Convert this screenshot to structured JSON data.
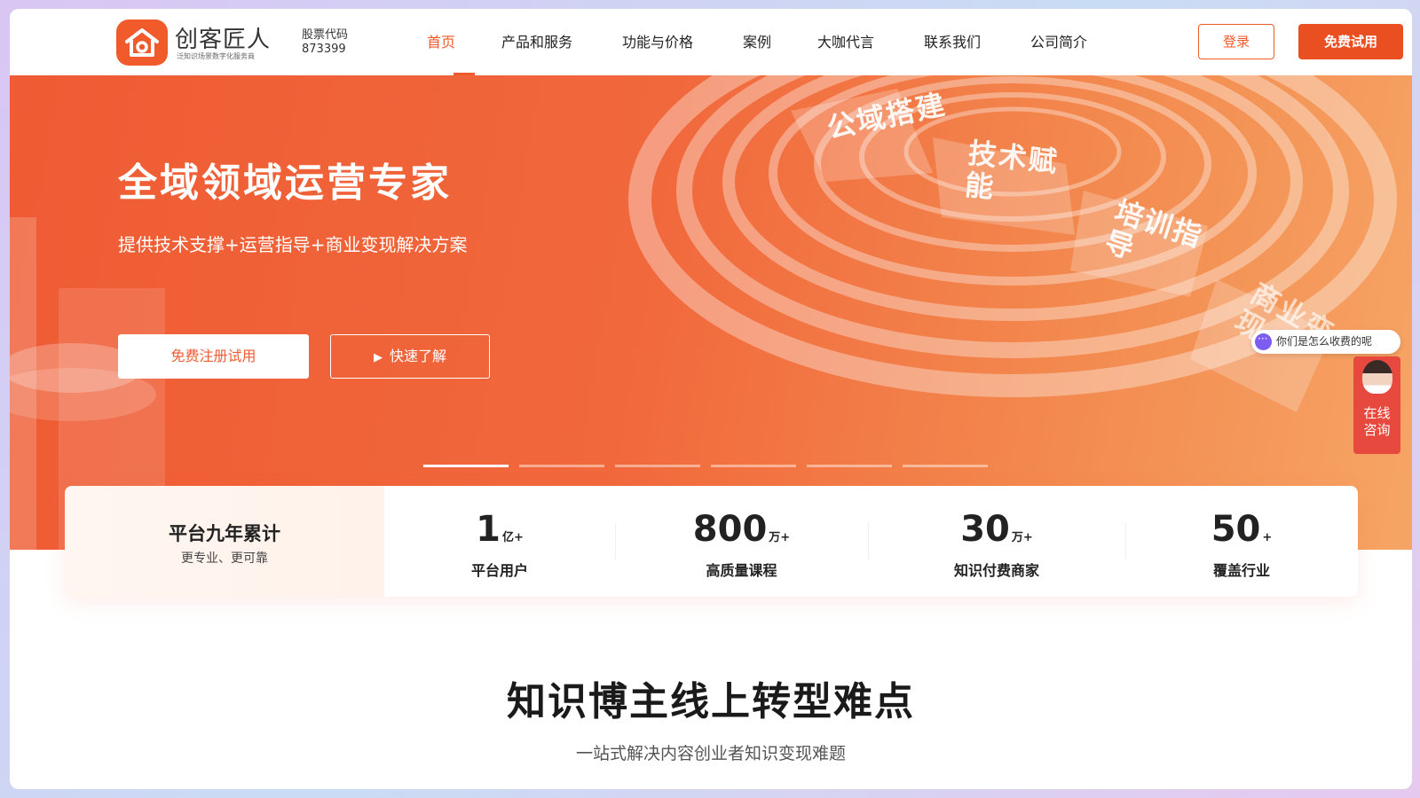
{
  "brand": {
    "logo_text": "创客匠人",
    "logo_sub": "泛知识场景数字化服务商",
    "stock_label": "股票代码",
    "stock_code": "873399"
  },
  "nav": {
    "items": [
      {
        "label": "首页",
        "active": true
      },
      {
        "label": "产品和服务"
      },
      {
        "label": "功能与价格"
      },
      {
        "label": "案例"
      },
      {
        "label": "大咖代言"
      },
      {
        "label": "联系我们"
      },
      {
        "label": "公司简介"
      }
    ],
    "login_label": "登录",
    "trial_label": "免费试用"
  },
  "hero": {
    "title": "全域领域运营专家",
    "subtitle": "提供技术支撑+运营指导+商业变现解决方案",
    "primary_btn": "免费注册试用",
    "secondary_btn": "快速了解",
    "ring_labels": [
      "公域搭建",
      "技术赋能",
      "培训指导",
      "商业变现"
    ],
    "carousel": {
      "total": 6,
      "active": 1
    }
  },
  "chat": {
    "bubble": "你们是怎么收费的呢",
    "consult_line1": "在线",
    "consult_line2": "咨询"
  },
  "stats": {
    "lead_title": "平台九年累计",
    "lead_sub": "更专业、更可靠",
    "items": [
      {
        "num": "1",
        "unit": "亿+",
        "label": "平台用户"
      },
      {
        "num": "800",
        "unit": "万+",
        "label": "高质量课程"
      },
      {
        "num": "30",
        "unit": "万+",
        "label": "知识付费商家"
      },
      {
        "num": "50",
        "unit": "+",
        "label": "覆盖行业"
      }
    ]
  },
  "section": {
    "title": "知识博主线上转型难点",
    "subtitle": "一站式解决内容创业者知识变现难题"
  },
  "colors": {
    "accent": "#f15a2b",
    "hero_start": "#ef5b34",
    "hero_end": "#f6a565"
  }
}
